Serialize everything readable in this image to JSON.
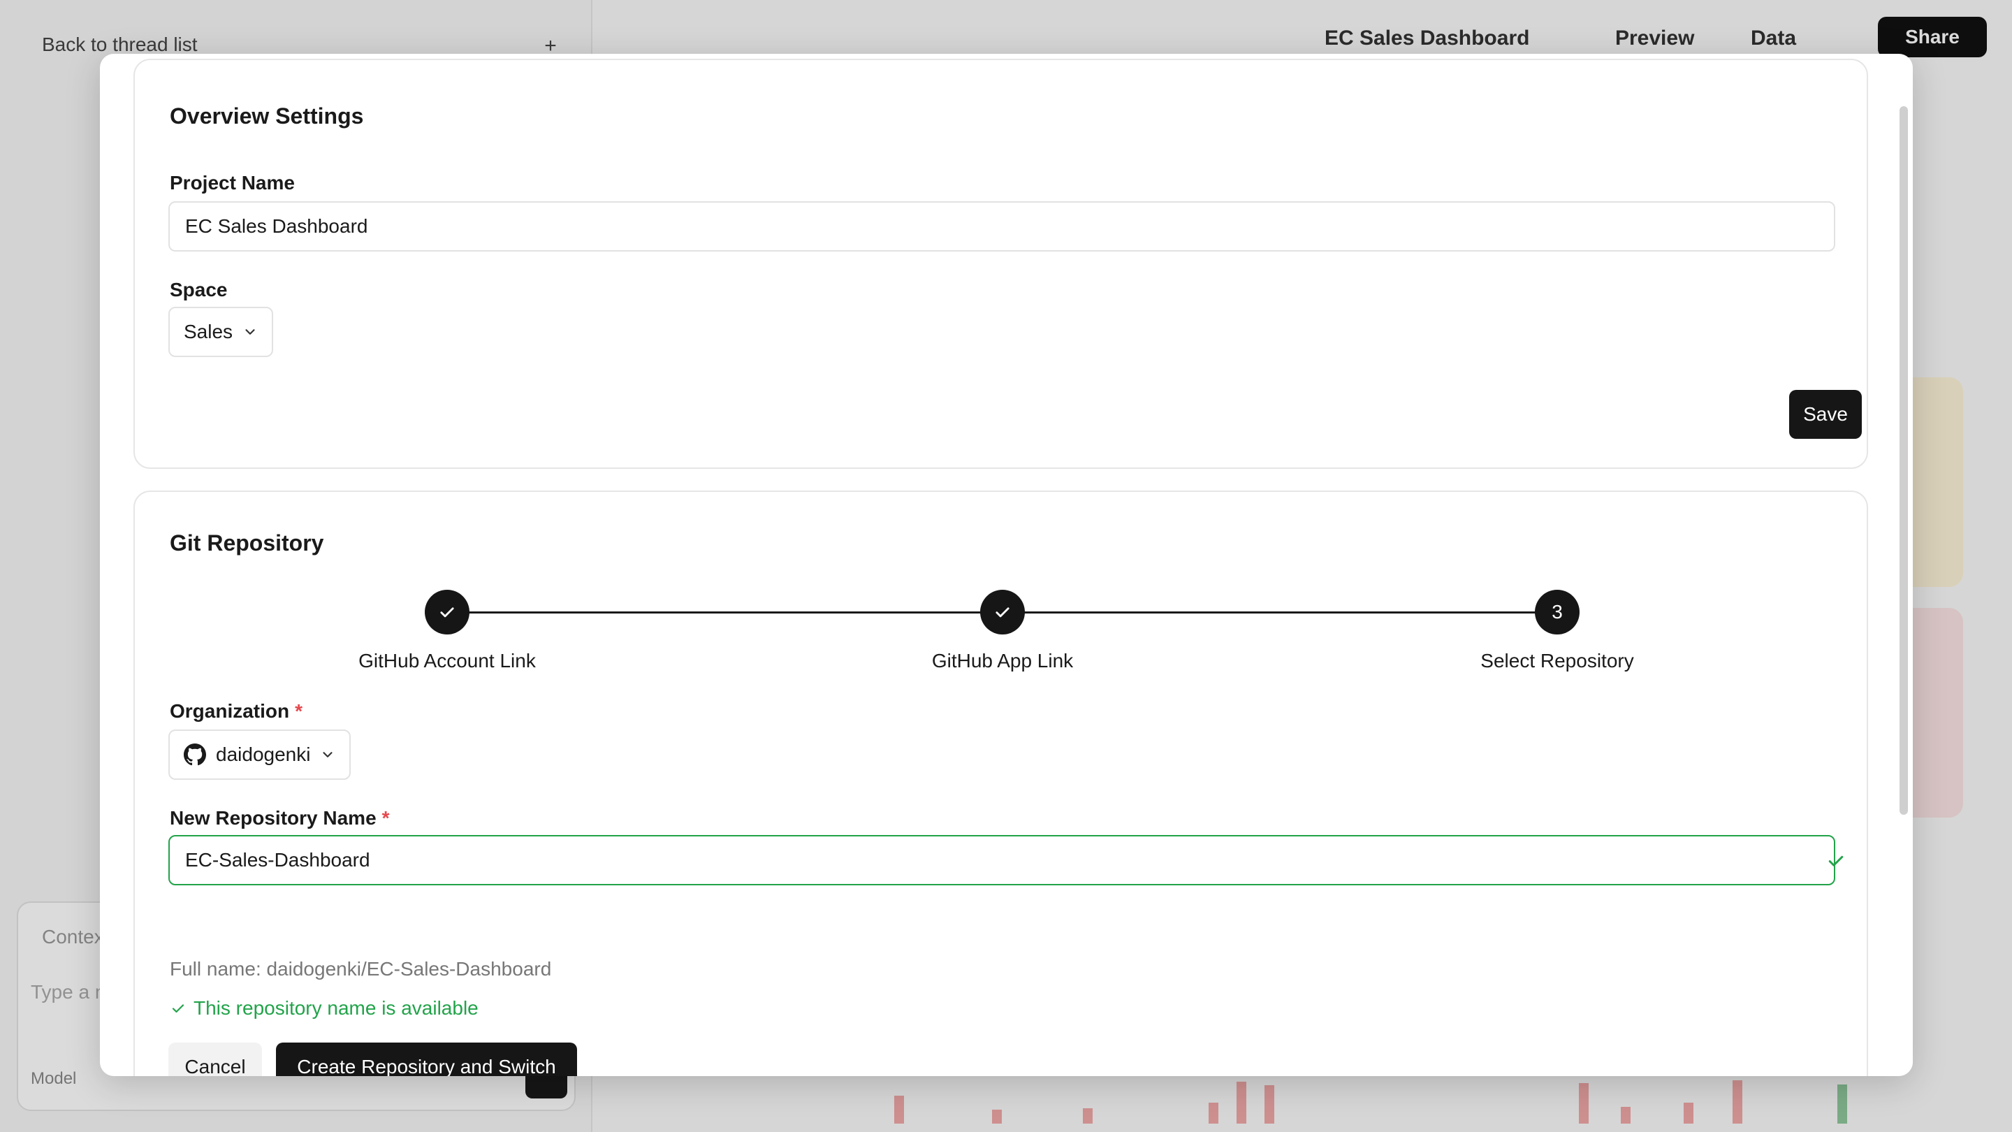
{
  "background": {
    "back_label": "Back to thread list",
    "project_selector": "EC Sales Dashboard",
    "tab_preview": "Preview",
    "tab_data": "Data",
    "share_label": "Share",
    "chat_attach": "Context",
    "chat_placeholder": "Type a message...",
    "chat_mode": "Model"
  },
  "overview": {
    "title": "Overview Settings",
    "project_name_label": "Project Name",
    "project_name_value": "EC Sales Dashboard",
    "space_label": "Space",
    "space_value": "Sales",
    "save_label": "Save"
  },
  "git": {
    "title": "Git Repository",
    "steps": [
      {
        "label": "GitHub Account Link",
        "state": "done"
      },
      {
        "label": "GitHub App Link",
        "state": "done"
      },
      {
        "label": "Select Repository",
        "state": "current",
        "number": "3"
      }
    ],
    "organization_label": "Organization",
    "required_mark": "*",
    "organization_value": "daidogenki",
    "repo_name_label": "New Repository Name",
    "repo_name_value": "EC-Sales-Dashboard",
    "full_name_text": "Full name: daidogenki/EC-Sales-Dashboard",
    "available_text": "This repository name is available",
    "cancel_label": "Cancel",
    "create_label": "Create Repository and Switch"
  },
  "colors": {
    "accent_dark": "#161616",
    "success_green": "#22a34a",
    "required_red": "#e5484d"
  }
}
